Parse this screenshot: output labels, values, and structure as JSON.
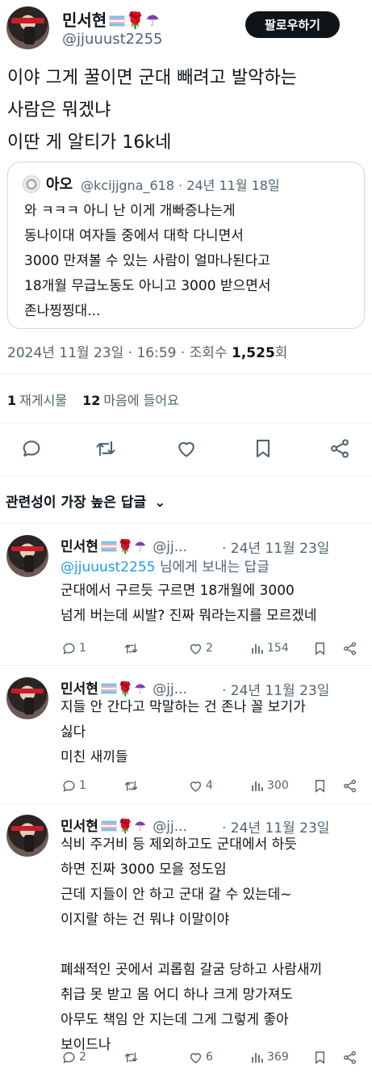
{
  "main_tweet": {
    "author_name": "민서현",
    "emojis": {
      "rose": "🌹",
      "umbrella": "☂"
    },
    "handle": "@jjuuust2255",
    "follow_label": "팔로우하기",
    "text": "이야 그게 꿀이면 군대 빼려고 발악하는\n사람은 뭐겠냐\n이딴 게 알티가 16k네",
    "quote": {
      "author_name": "아오",
      "meta": "@kcijjgna_618 · 24년 11월 18일",
      "text": "와 ㅋㅋㅋ 아니 난 이게 개빠증나는게\n동나이대 여자들 중에서 대학 다니면서\n3000 만져볼 수 있는 사람이 얼마나된다고\n18개월 무급노동도 아니고 3000 받으면서\n존나찡찡대..."
    },
    "timestamp": "2024년 11월 23일 · 16:59 · 조회수 ",
    "views": "1,525",
    "views_suffix": "회",
    "retweets_count": "1",
    "retweets_label": "재게시물",
    "likes_count": "12",
    "likes_label": "마음에 들어요"
  },
  "replies_header": {
    "label": "관련성이 가장 높은 답글",
    "chevron": "⌄"
  },
  "replies": [
    {
      "author_name": "민서현",
      "handle": "@jj...",
      "date": "· 24년 11월 23일",
      "reply_to_mention": "@jjuuust2255",
      "reply_to_suffix": " 님에게 보내는 답글",
      "text": "군대에서 구르듯 구르면 18개월에 3000\n넘게 버는데 씨발? 진짜 뭐라는지를 모르겠네",
      "replies": "1",
      "retweets": "",
      "likes": "2",
      "views": "154"
    },
    {
      "author_name": "민서현",
      "handle": "@jj...",
      "date": "· 24년 11월 23일",
      "text": "지들 안 간다고 막말하는 건 존나 꼴 보기가\n싫다\n미친 새끼들",
      "replies": "1",
      "retweets": "",
      "likes": "4",
      "views": "300"
    },
    {
      "author_name": "민서현",
      "handle": "@jj...",
      "date": "· 24년 11월 23일",
      "text": "식비 주거비 등 제외하고도 군대에서 하듯\n하면 진짜 3000 모을 정도임\n근데 지들이 안 하고 군대 갈 수 있는데~\n이지랄 하는 건 뭐냐 이말이야\n\n폐쇄적인 곳에서 괴롭힘 갈굼 당하고 사람새끼\n취급 못 받고 몸 어디 하나 크게 망가져도\n아무도 책임 안 지는데 그게 그렇게 좋아\n보이드나",
      "replies": "2",
      "retweets": "",
      "likes": "6",
      "views": "369"
    }
  ]
}
